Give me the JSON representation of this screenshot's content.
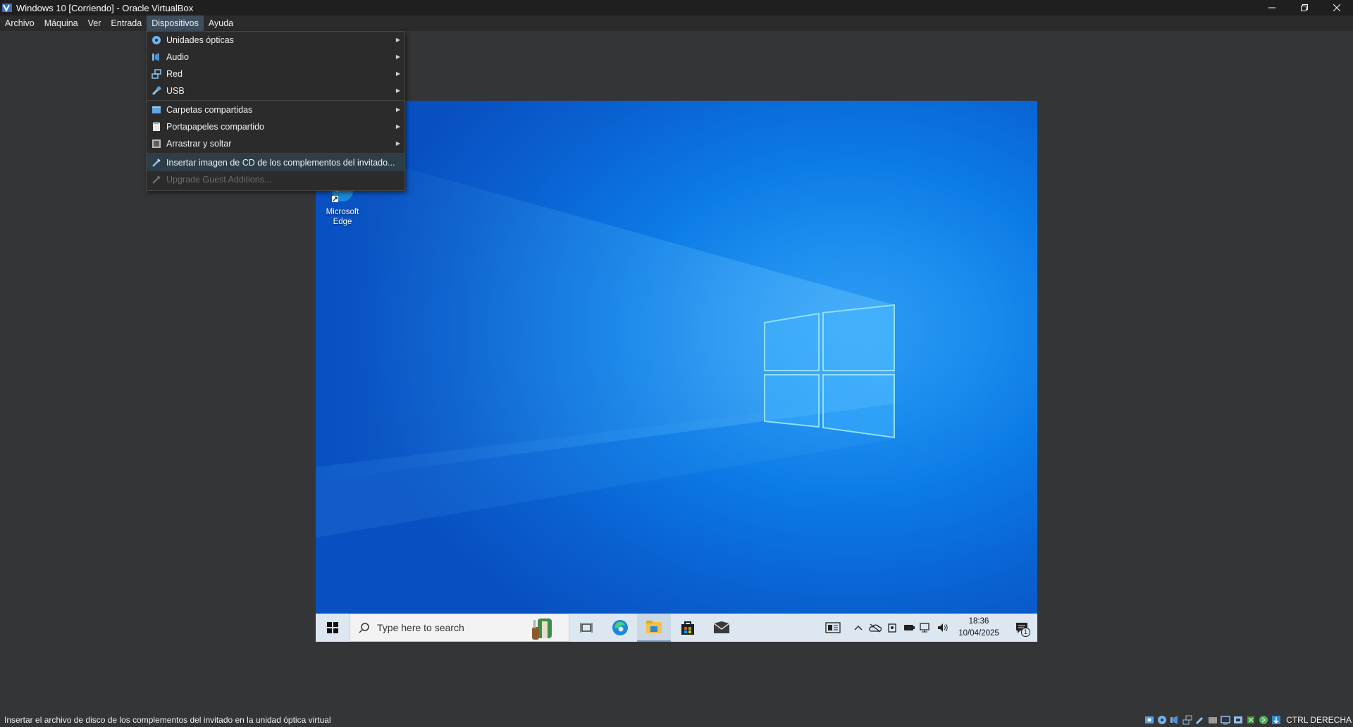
{
  "window": {
    "title": "Windows 10  [Corriendo] - Oracle VirtualBox",
    "controls": [
      "minimize-icon",
      "restore-icon",
      "close-icon"
    ]
  },
  "menubar": {
    "items": [
      "Archivo",
      "Máquina",
      "Ver",
      "Entrada",
      "Dispositivos",
      "Ayuda"
    ],
    "active": "Dispositivos"
  },
  "devices_menu": {
    "items": [
      {
        "label": "Unidades ópticas",
        "icon": "optical-disc-icon",
        "submenu": true
      },
      {
        "label": "Audio",
        "icon": "audio-icon",
        "submenu": true
      },
      {
        "label": "Red",
        "icon": "network-icon",
        "submenu": true
      },
      {
        "label": "USB",
        "icon": "usb-icon",
        "submenu": true
      },
      {
        "label": "Carpetas compartidas",
        "icon": "shared-folder-icon",
        "submenu": true
      },
      {
        "label": "Portapapeles compartido",
        "icon": "clipboard-icon",
        "submenu": true
      },
      {
        "label": "Arrastrar y soltar",
        "icon": "drag-drop-icon",
        "submenu": true
      },
      {
        "label": "Insertar imagen de CD de los complementos del invitado...",
        "icon": "guest-additions-icon",
        "highlighted": true
      },
      {
        "label": "Upgrade Guest Additions...",
        "icon": "guest-additions-icon",
        "disabled": true
      }
    ]
  },
  "guest": {
    "desktop_icons": [
      {
        "label_line1": "Microsoft",
        "label_line2": "Edge"
      }
    ],
    "taskbar": {
      "search_placeholder": "Type here to search",
      "clock_time": "18:36",
      "clock_date": "10/04/2025",
      "notification_count": "1"
    }
  },
  "statusbar": {
    "message": "Insertar el archivo de disco de los complementos del invitado en la unidad óptica virtual",
    "host_key": "CTRL DERECHA"
  },
  "colors": {
    "menu_highlight": "#2e3e48",
    "menubar_active": "#3f4e5c",
    "taskbar": "#dce7f2",
    "desktop_blue": "#0b79e4"
  }
}
